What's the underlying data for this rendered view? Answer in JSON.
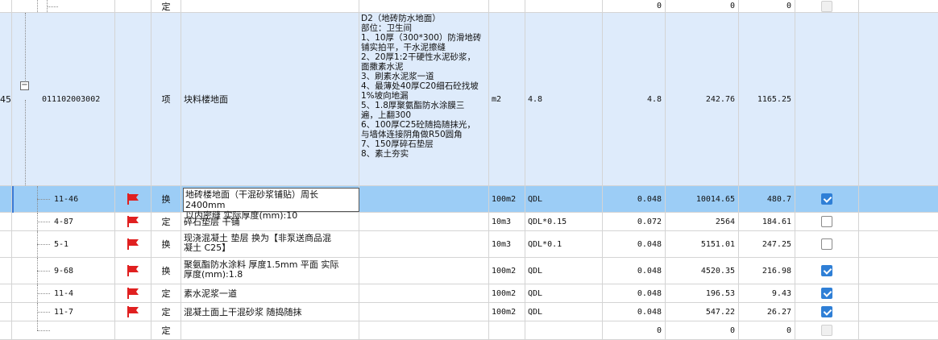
{
  "parent": {
    "index": "45",
    "code": "011102003002",
    "type": "项",
    "name": "块料楼地面",
    "features": "D2（地砖防水地面）\n部位：卫生间\n1、10厚（300*300）防滑地砖\n铺实拍平，干水泥擦缝\n2、20厚1:2干硬性水泥砂浆，\n面撒素水泥\n3、刷素水泥浆一道\n4、最薄处40厚C20细石砼找坡\n1%坡向地漏\n5、1.8厚聚氨酯防水涂膜三\n遍，上翻300\n6、100厚C25砼随捣随抹光，\n与墙体连接阴角做R50圆角\n7、150厚碎石垫层\n8、素土夯实",
    "unit": "m2",
    "expr": "4.8",
    "qty": "4.8",
    "price": "242.76",
    "total": "1165.25"
  },
  "top_row": {
    "type": "定",
    "qty": "0",
    "price": "0",
    "total": "0"
  },
  "bottom_row": {
    "type": "定",
    "qty": "0",
    "price": "0",
    "total": "0"
  },
  "rows": [
    {
      "code": "11-46",
      "type": "换",
      "name": "地砖楼地面（干混砂浆铺贴）周长2400mm以内密缝  实际厚度(mm):10",
      "name_l1": "地砖楼地面（干混砂浆铺贴）周长2400mm",
      "name_l2": "以内密缝  实际厚度(mm):10",
      "unit": "100m2",
      "expr": "QDL",
      "qty": "0.048",
      "price": "10014.65",
      "total": "480.7",
      "checked": true,
      "selected": true
    },
    {
      "code": "4-87",
      "type": "定",
      "name": "碎石垫层 干铺",
      "unit": "10m3",
      "expr": "QDL*0.15",
      "qty": "0.072",
      "price": "2564",
      "total": "184.61",
      "checked": false
    },
    {
      "code": "5-1",
      "type": "换",
      "name_l1": "现浇混凝土 垫层  换为【非泵送商品混",
      "name_l2": "凝土 C25】",
      "unit": "10m3",
      "expr": "QDL*0.1",
      "qty": "0.048",
      "price": "5151.01",
      "total": "247.25",
      "checked": false
    },
    {
      "code": "9-68",
      "type": "换",
      "name_l1": "聚氨酯防水涂料 厚度1.5mm 平面  实际",
      "name_l2": "厚度(mm):1.8",
      "unit": "100m2",
      "expr": "QDL",
      "qty": "0.048",
      "price": "4520.35",
      "total": "216.98",
      "checked": true
    },
    {
      "code": "11-4",
      "type": "定",
      "name": "素水泥浆一道",
      "unit": "100m2",
      "expr": "QDL",
      "qty": "0.048",
      "price": "196.53",
      "total": "9.43",
      "checked": true
    },
    {
      "code": "11-7",
      "type": "定",
      "name": "混凝土面上干混砂浆 随捣随抹",
      "unit": "100m2",
      "expr": "QDL",
      "qty": "0.048",
      "price": "547.22",
      "total": "26.27",
      "checked": true
    }
  ],
  "colors": {
    "selected_row": "#9ccdf6",
    "parent_row": "#deebfb",
    "flag": "#e02020",
    "check": "#2f7fd6"
  },
  "icons": {
    "flag": "red-flag-icon",
    "expander": "collapse-minus-icon",
    "checkbox": "checkbox-icon"
  }
}
